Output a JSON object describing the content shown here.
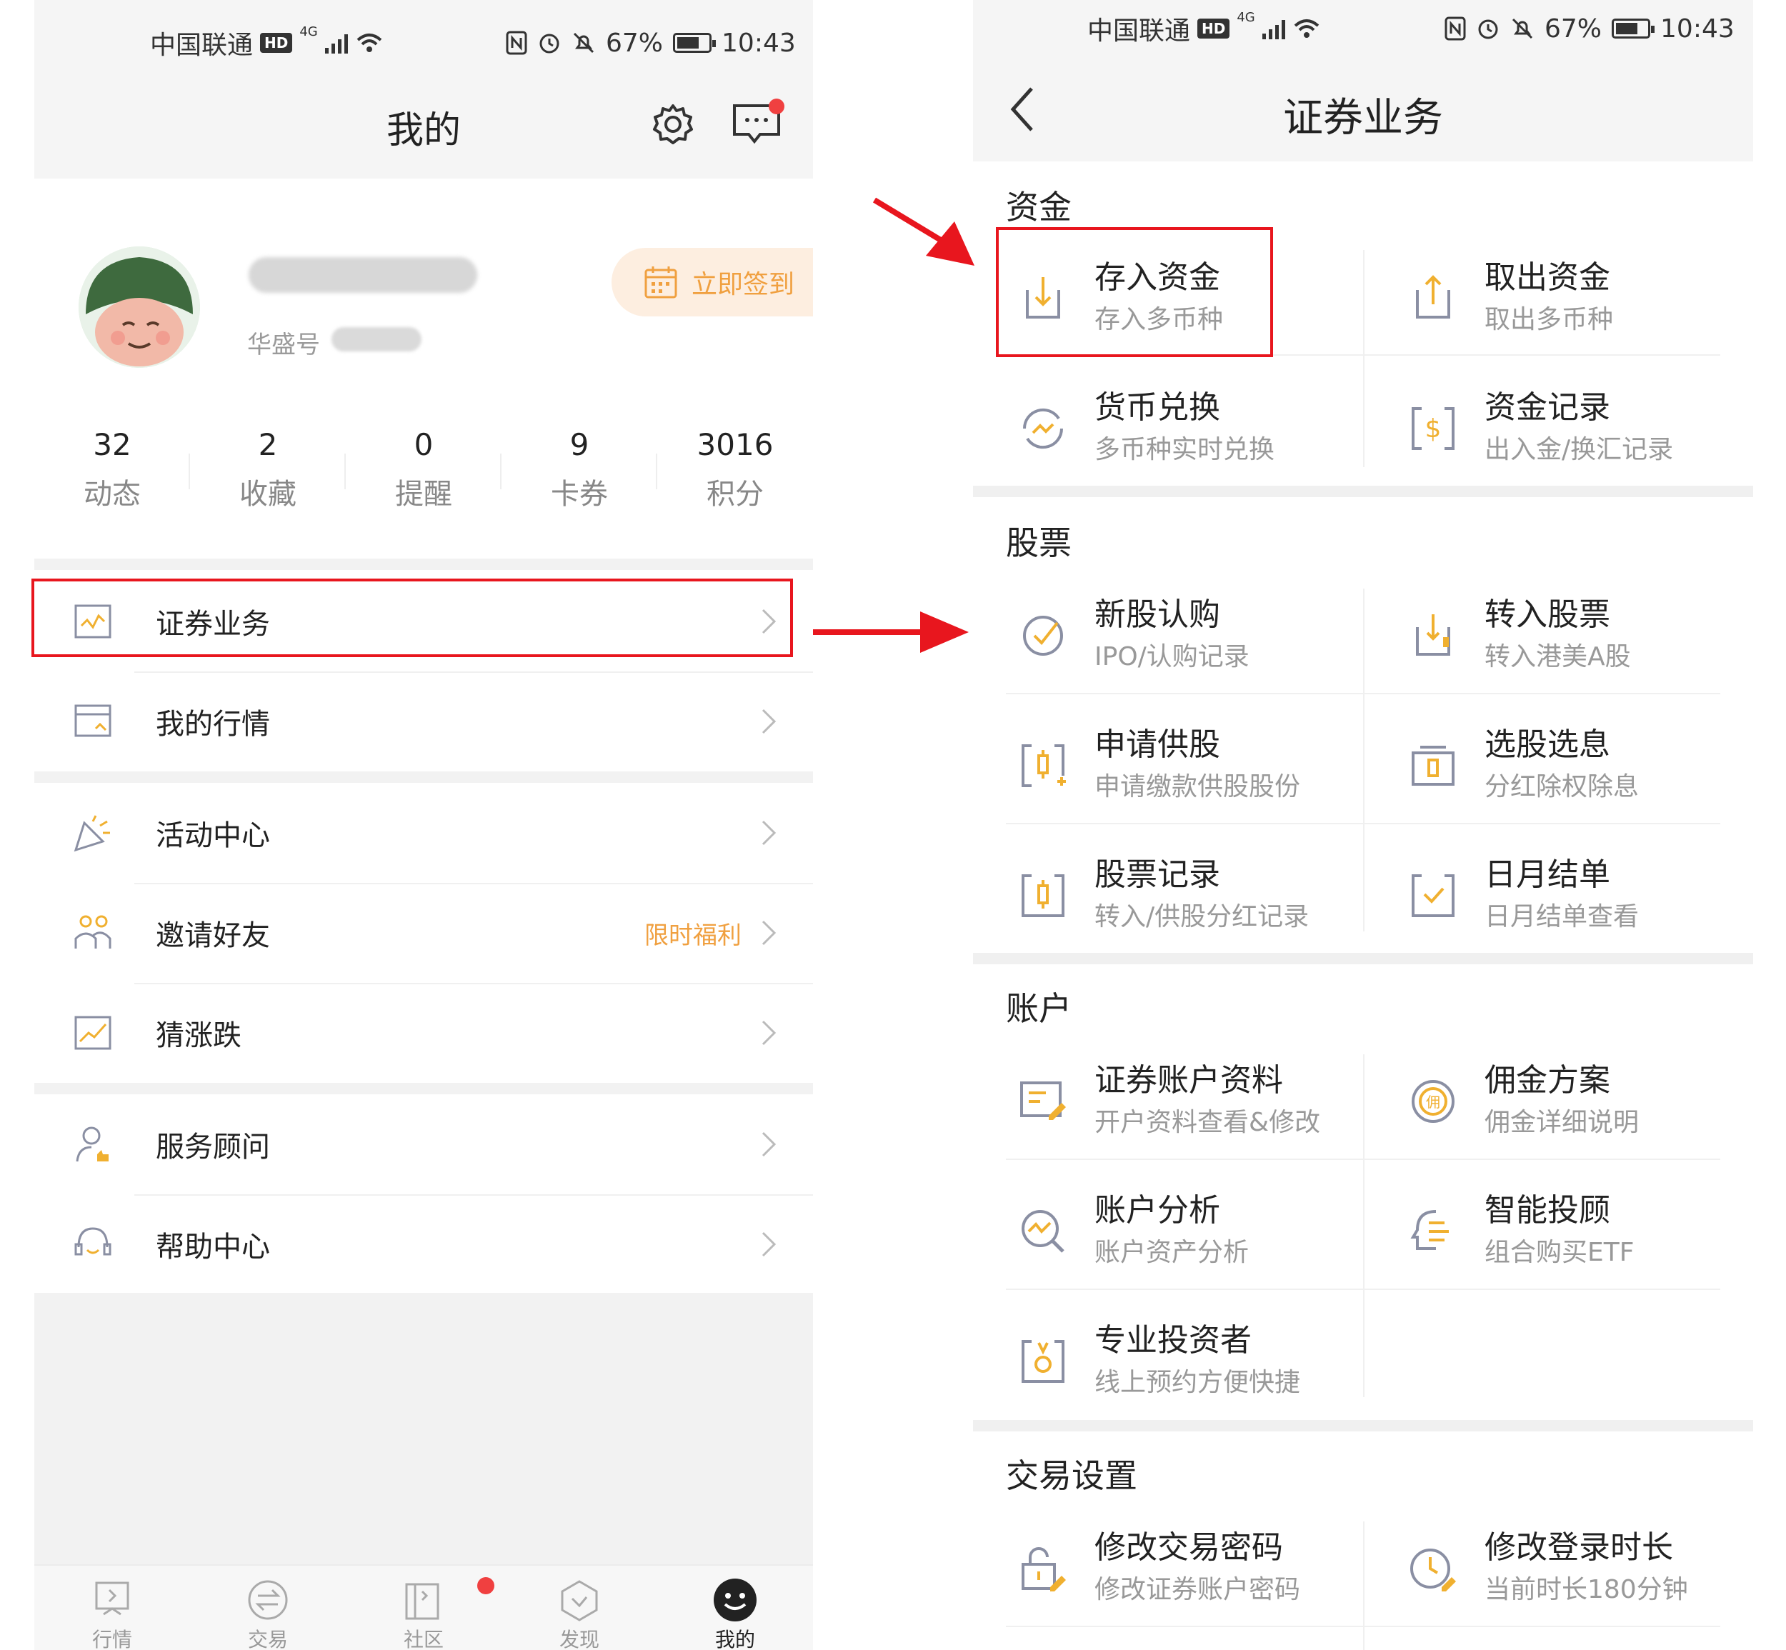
{
  "left": {
    "status": {
      "carrier": "中国联通",
      "hd": "HD",
      "net": "4G",
      "battery": "67%",
      "time": "10:43"
    },
    "title": "我的",
    "profile": {
      "id_label": "华盛号",
      "signin_label": "立即签到"
    },
    "stats": [
      {
        "value": "32",
        "label": "动态"
      },
      {
        "value": "2",
        "label": "收藏"
      },
      {
        "value": "0",
        "label": "提醒"
      },
      {
        "value": "9",
        "label": "卡券"
      },
      {
        "value": "3016",
        "label": "积分"
      }
    ],
    "menu": {
      "securities": "证券业务",
      "my_quotes": "我的行情",
      "activity": "活动中心",
      "invite": "邀请好友",
      "invite_badge": "限时福利",
      "guess": "猜涨跌",
      "advisor": "服务顾问",
      "help": "帮助中心"
    },
    "nav": [
      {
        "label": "行情"
      },
      {
        "label": "交易"
      },
      {
        "label": "社区"
      },
      {
        "label": "发现"
      },
      {
        "label": "我的"
      }
    ]
  },
  "right": {
    "status": {
      "carrier": "中国联通",
      "hd": "HD",
      "net": "4G",
      "battery": "67%",
      "time": "10:43"
    },
    "title": "证券业务",
    "sections": {
      "funds": {
        "title": "资金",
        "items": [
          {
            "title": "存入资金",
            "sub": "存入多币种"
          },
          {
            "title": "取出资金",
            "sub": "取出多币种"
          },
          {
            "title": "货币兑换",
            "sub": "多币种实时兑换"
          },
          {
            "title": "资金记录",
            "sub": "出入金/换汇记录"
          }
        ]
      },
      "stocks": {
        "title": "股票",
        "items": [
          {
            "title": "新股认购",
            "sub": "IPO/认购记录"
          },
          {
            "title": "转入股票",
            "sub": "转入港美A股"
          },
          {
            "title": "申请供股",
            "sub": "申请缴款供股股份"
          },
          {
            "title": "选股选息",
            "sub": "分红除权除息"
          },
          {
            "title": "股票记录",
            "sub": "转入/供股分红记录"
          },
          {
            "title": "日月结单",
            "sub": "日月结单查看"
          }
        ]
      },
      "account": {
        "title": "账户",
        "items": [
          {
            "title": "证券账户资料",
            "sub": "开户资料查看&修改"
          },
          {
            "title": "佣金方案",
            "sub": "佣金详细说明"
          },
          {
            "title": "账户分析",
            "sub": "账户资产分析"
          },
          {
            "title": "智能投顾",
            "sub": "组合购买ETF"
          },
          {
            "title": "专业投资者",
            "sub": "线上预约方便快捷"
          }
        ]
      },
      "trade": {
        "title": "交易设置",
        "items": [
          {
            "title": "修改交易密码",
            "sub": "修改证券账户密码"
          },
          {
            "title": "修改登录时长",
            "sub": "当前时长180分钟"
          }
        ]
      }
    }
  },
  "colors": {
    "accent": "#f0a040",
    "highlight": "#e8161e",
    "badge_dot": "#f04040",
    "icon_gray": "#8a8fa3"
  }
}
